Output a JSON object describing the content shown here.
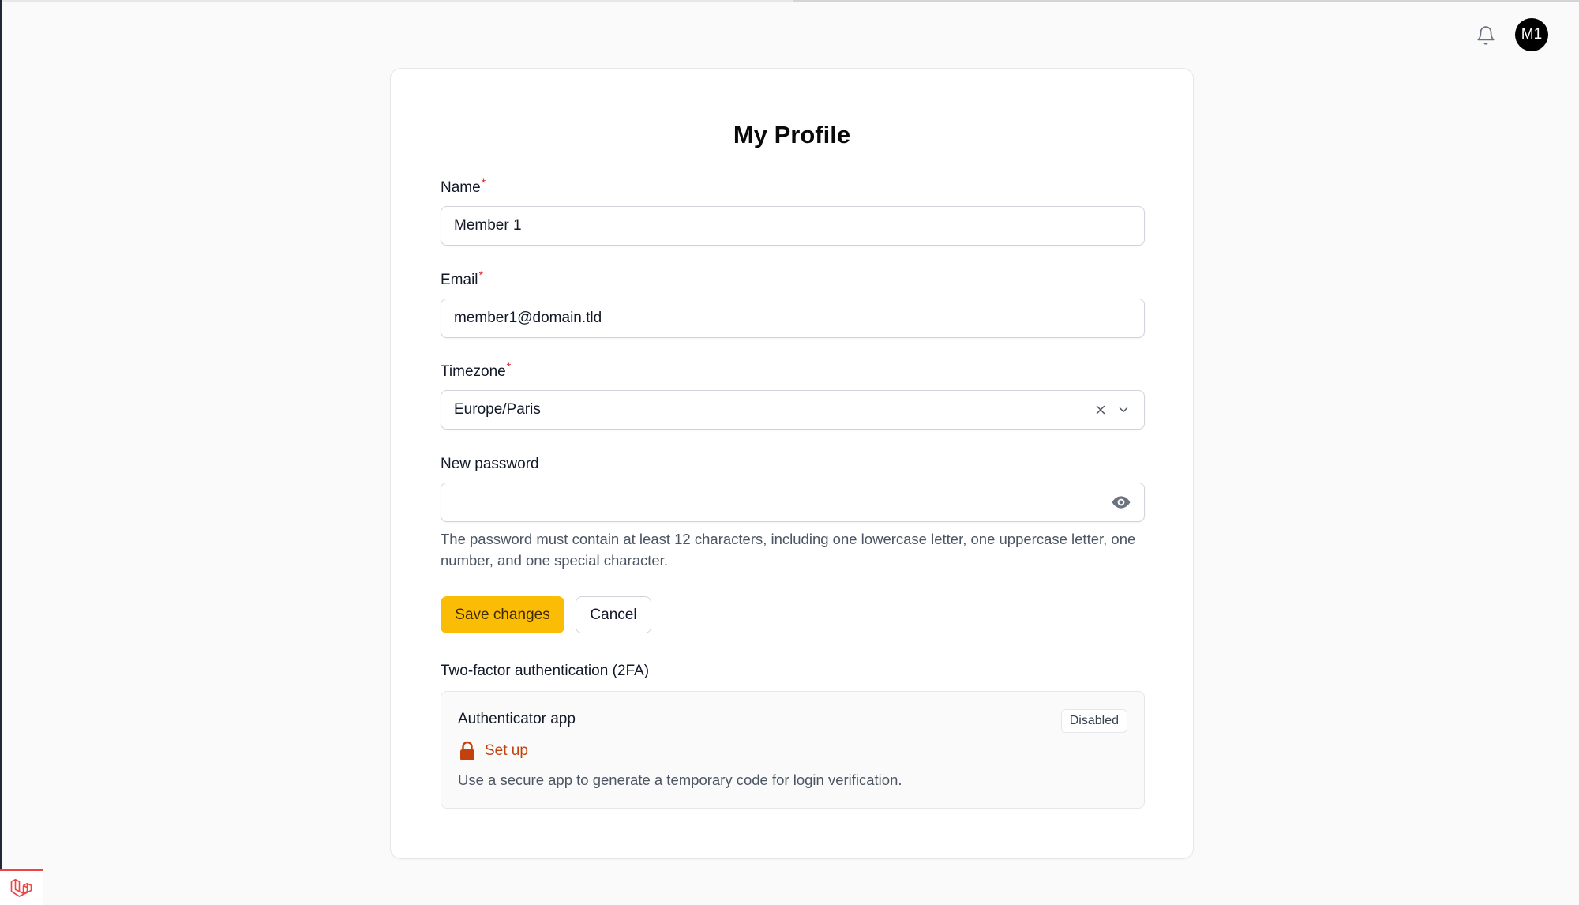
{
  "header": {
    "avatar_initials": "M1"
  },
  "profile": {
    "title": "My Profile",
    "name": {
      "label": "Name",
      "required_mark": "*",
      "value": "Member 1"
    },
    "email": {
      "label": "Email",
      "required_mark": "*",
      "value": "member1@domain.tld"
    },
    "timezone": {
      "label": "Timezone",
      "required_mark": "*",
      "value": "Europe/Paris"
    },
    "password": {
      "label": "New password",
      "value": "",
      "hint": "The password must contain at least 12 characters, including one lowercase letter, one uppercase letter, one number, and one special character."
    },
    "actions": {
      "save_label": "Save changes",
      "cancel_label": "Cancel"
    }
  },
  "twofa": {
    "section_title": "Two-factor authentication (2FA)",
    "app_name": "Authenticator app",
    "status": "Disabled",
    "setup_label": "Set up",
    "description": "Use a secure app to generate a temporary code for login verification."
  },
  "colors": {
    "accent": "#fbbc05",
    "link": "#c2410c",
    "required": "#dc2626"
  },
  "icons": [
    "bell-icon",
    "clear-icon",
    "chevron-down-icon",
    "eye-icon",
    "lock-icon",
    "laravel-icon"
  ]
}
